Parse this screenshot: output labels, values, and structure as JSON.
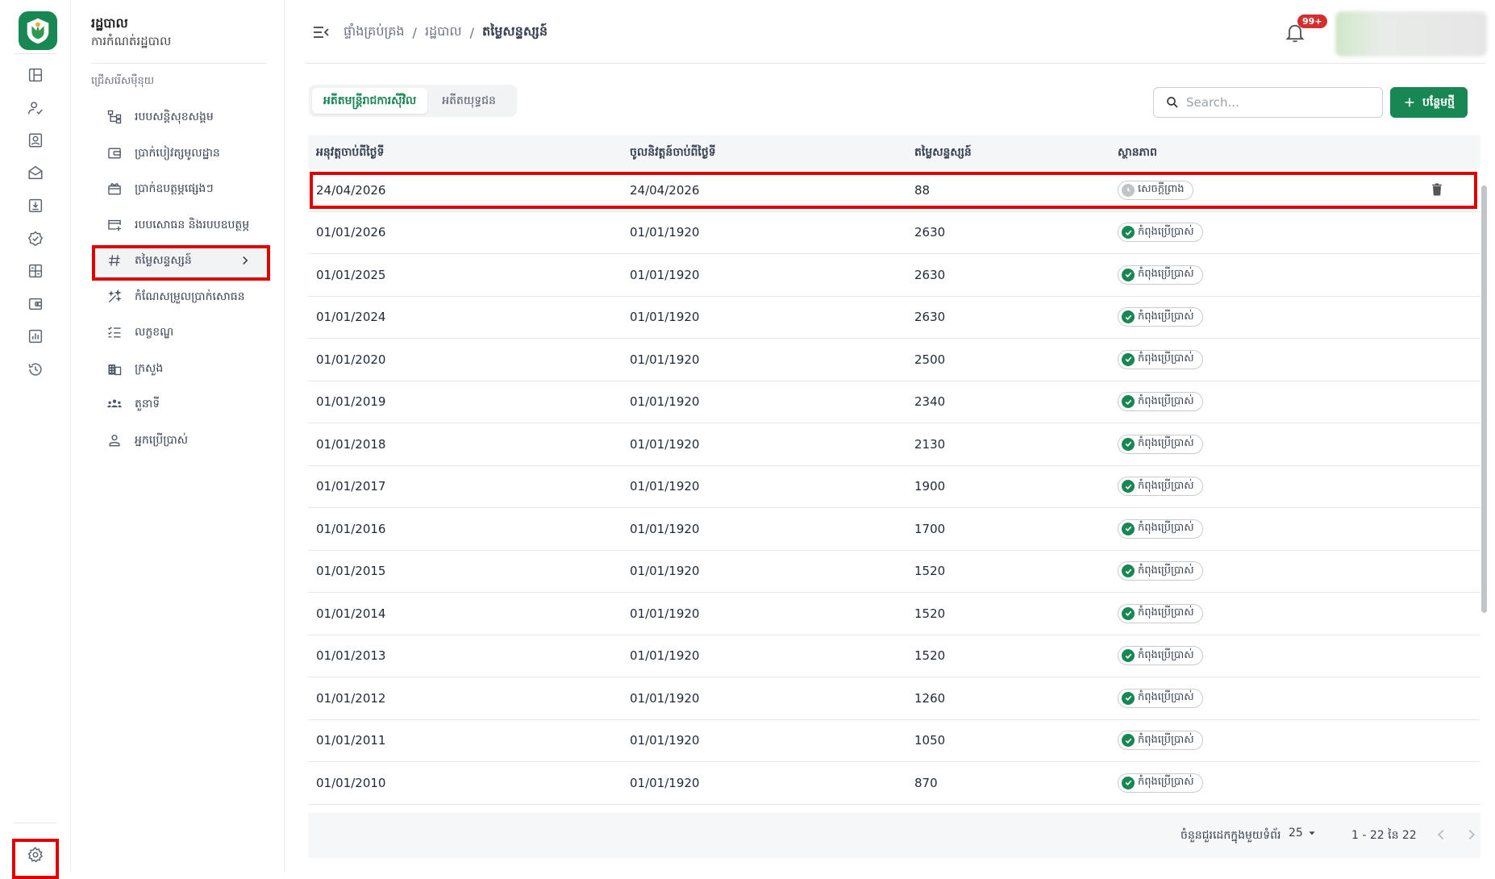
{
  "sidebar_header": {
    "title": "រដ្ឋបាល",
    "subtitle": "ការកំណត់រដ្ឋបាល"
  },
  "menu": {
    "section_label": "ជ្រើសរើសម៉ឺនុយ",
    "items": [
      {
        "label": "របបសន្តិសុខសង្គម",
        "icon": "hierarchy-icon"
      },
      {
        "label": "ប្រាក់បៀវត្សមូលដ្ឋាន",
        "icon": "wallet-icon"
      },
      {
        "label": "ប្រាក់ឧបត្ថម្ភផ្សេងៗ",
        "icon": "gift-icon"
      },
      {
        "label": "របបសោធន និងរបបឧបត្ថម្ភ",
        "icon": "card-plus-icon"
      },
      {
        "label": "តម្លៃសន្ទស្សន៍",
        "icon": "hash-icon",
        "active": true
      },
      {
        "label": "កំណែសម្រួលប្រាក់សោធន",
        "icon": "sparkle-icon"
      },
      {
        "label": "លក្ខខណ្ឌ",
        "icon": "checklist-icon"
      },
      {
        "label": "ក្រសួង",
        "icon": "building-icon"
      },
      {
        "label": "តួនាទី",
        "icon": "group-icon"
      },
      {
        "label": "អ្នកប្រើប្រាស់",
        "icon": "person-icon"
      }
    ]
  },
  "header": {
    "breadcrumb": [
      "ផ្ទាំងគ្រប់គ្រង",
      "រដ្ឋបាល",
      "តម្លៃសន្ទស្សន៍"
    ],
    "notification_count": "99+"
  },
  "tabs": [
    {
      "label": "អតីតមន្ត្រីរាជការស៊ីវិល",
      "active": true
    },
    {
      "label": "អតីតយុទ្ធជន",
      "active": false
    }
  ],
  "search": {
    "placeholder": "Search..."
  },
  "add_button": {
    "label": "បន្ថែមថ្មី"
  },
  "table": {
    "columns": [
      "អនុវត្តចាប់ពីថ្ងៃទី",
      "ចូលនិវត្តន៍ចាប់ពីថ្ងៃទី",
      "តម្លៃសន្ទស្សន៍",
      "ស្ថានភាព"
    ],
    "rows": [
      {
        "effective": "24/04/2026",
        "retire": "24/04/2026",
        "value": "88",
        "status": "សេចក្តីព្រាង",
        "status_type": "draft",
        "deletable": true
      },
      {
        "effective": "01/01/2026",
        "retire": "01/01/1920",
        "value": "2630",
        "status": "កំពុងប្រើប្រាស់",
        "status_type": "active"
      },
      {
        "effective": "01/01/2025",
        "retire": "01/01/1920",
        "value": "2630",
        "status": "កំពុងប្រើប្រាស់",
        "status_type": "active"
      },
      {
        "effective": "01/01/2024",
        "retire": "01/01/1920",
        "value": "2630",
        "status": "កំពុងប្រើប្រាស់",
        "status_type": "active"
      },
      {
        "effective": "01/01/2020",
        "retire": "01/01/1920",
        "value": "2500",
        "status": "កំពុងប្រើប្រាស់",
        "status_type": "active"
      },
      {
        "effective": "01/01/2019",
        "retire": "01/01/1920",
        "value": "2340",
        "status": "កំពុងប្រើប្រាស់",
        "status_type": "active"
      },
      {
        "effective": "01/01/2018",
        "retire": "01/01/1920",
        "value": "2130",
        "status": "កំពុងប្រើប្រាស់",
        "status_type": "active"
      },
      {
        "effective": "01/01/2017",
        "retire": "01/01/1920",
        "value": "1900",
        "status": "កំពុងប្រើប្រាស់",
        "status_type": "active"
      },
      {
        "effective": "01/01/2016",
        "retire": "01/01/1920",
        "value": "1700",
        "status": "កំពុងប្រើប្រាស់",
        "status_type": "active"
      },
      {
        "effective": "01/01/2015",
        "retire": "01/01/1920",
        "value": "1520",
        "status": "កំពុងប្រើប្រាស់",
        "status_type": "active"
      },
      {
        "effective": "01/01/2014",
        "retire": "01/01/1920",
        "value": "1520",
        "status": "កំពុងប្រើប្រាស់",
        "status_type": "active"
      },
      {
        "effective": "01/01/2013",
        "retire": "01/01/1920",
        "value": "1520",
        "status": "កំពុងប្រើប្រាស់",
        "status_type": "active"
      },
      {
        "effective": "01/01/2012",
        "retire": "01/01/1920",
        "value": "1260",
        "status": "កំពុងប្រើប្រាស់",
        "status_type": "active"
      },
      {
        "effective": "01/01/2011",
        "retire": "01/01/1920",
        "value": "1050",
        "status": "កំពុងប្រើប្រាស់",
        "status_type": "active"
      },
      {
        "effective": "01/01/2010",
        "retire": "01/01/1920",
        "value": "870",
        "status": "កំពុងប្រើប្រាស់",
        "status_type": "active"
      }
    ]
  },
  "pagination": {
    "rows_per_page_label": "ចំនួនជួរដេកក្នុងមួយទំព័រ",
    "rows_per_page": "25",
    "range": "1 - 22 នៃ 22"
  },
  "colors": {
    "brand": "#198754",
    "highlight": "#e00000",
    "badge": "#d32f2f"
  }
}
